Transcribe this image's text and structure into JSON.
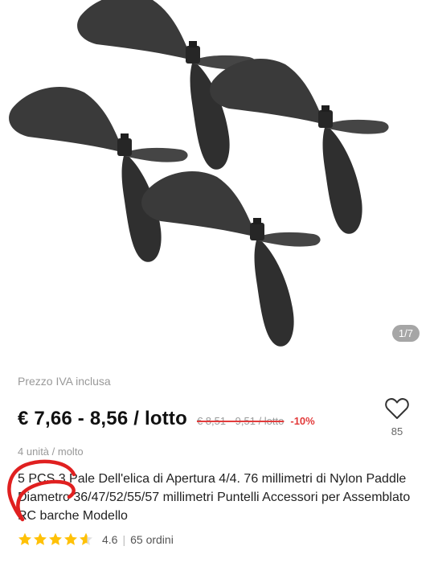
{
  "gallery": {
    "image_alt": "Eliche nere a due pale",
    "counter": "1/7"
  },
  "price": {
    "vat_note": "Prezzo IVA inclusa",
    "range": "€ 7,66 - 8,56 / lotto",
    "original": "€ 8,51 - 9,51 / lotto",
    "discount": "-10%",
    "lot_size": "4 unità / molto"
  },
  "wishlist": {
    "icon": "heart-icon",
    "count": "85"
  },
  "product": {
    "title": "5 PCS 3 Pale Dell'elica di Apertura 4/4. 76 millimetri di Nylon Paddle Diametro 36/47/52/55/57 millimetri Puntelli Accessori per Assemblato RC barche Modello"
  },
  "rating": {
    "stars": 4.6,
    "score": "4.6",
    "orders": "65 ordini",
    "star_color": "#ffc107"
  },
  "colors": {
    "price": "#111111",
    "discount": "#e23b3b",
    "annotation": "#e02020"
  }
}
